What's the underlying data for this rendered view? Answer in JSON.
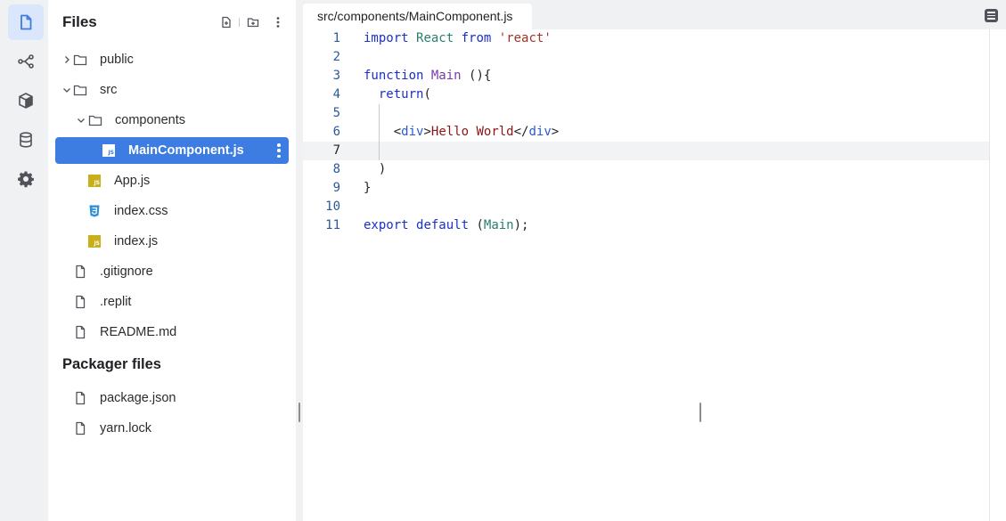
{
  "rail": {
    "items": [
      {
        "name": "files-icon",
        "active": true
      },
      {
        "name": "version-control-icon",
        "active": false
      },
      {
        "name": "packages-icon",
        "active": false
      },
      {
        "name": "database-icon",
        "active": false
      },
      {
        "name": "settings-icon",
        "active": false
      }
    ]
  },
  "files_panel": {
    "title": "Files",
    "tree": [
      {
        "label": "public",
        "type": "folder",
        "expanded": false,
        "depth": 0
      },
      {
        "label": "src",
        "type": "folder",
        "expanded": true,
        "depth": 0
      },
      {
        "label": "components",
        "type": "folder",
        "expanded": true,
        "depth": 1
      },
      {
        "label": "MainComponent.js",
        "type": "js",
        "depth": 2,
        "selected": true
      },
      {
        "label": "App.js",
        "type": "js",
        "depth": 1
      },
      {
        "label": "index.css",
        "type": "css",
        "depth": 1
      },
      {
        "label": "index.js",
        "type": "js",
        "depth": 1
      },
      {
        "label": ".gitignore",
        "type": "file",
        "depth": 0
      },
      {
        "label": ".replit",
        "type": "file",
        "depth": 0
      },
      {
        "label": "README.md",
        "type": "file",
        "depth": 0
      }
    ],
    "packager_title": "Packager files",
    "packager_files": [
      {
        "label": "package.json",
        "type": "file"
      },
      {
        "label": "yarn.lock",
        "type": "file"
      }
    ],
    "js_badge_text": "JS"
  },
  "editor": {
    "tab_label": "src/components/MainComponent.js",
    "current_line": 7,
    "lines": [
      {
        "n": "1",
        "tokens": [
          {
            "t": "import",
            "c": "kw"
          },
          {
            "t": " "
          },
          {
            "t": "React",
            "c": "cls"
          },
          {
            "t": " "
          },
          {
            "t": "from",
            "c": "kw"
          },
          {
            "t": " "
          },
          {
            "t": "'react'",
            "c": "str"
          }
        ]
      },
      {
        "n": "2",
        "tokens": []
      },
      {
        "n": "3",
        "tokens": [
          {
            "t": "function",
            "c": "kw"
          },
          {
            "t": " "
          },
          {
            "t": "Main",
            "c": "fn"
          },
          {
            "t": " (){",
            "c": "plain"
          }
        ]
      },
      {
        "n": "4",
        "tokens": [
          {
            "t": "  "
          },
          {
            "t": "return",
            "c": "kw"
          },
          {
            "t": "(",
            "c": "plain"
          }
        ]
      },
      {
        "n": "5",
        "tokens": []
      },
      {
        "n": "6",
        "tokens": [
          {
            "t": "    "
          },
          {
            "t": "<",
            "c": "plain"
          },
          {
            "t": "div",
            "c": "tag"
          },
          {
            "t": ">",
            "c": "plain"
          },
          {
            "t": "Hello World",
            "c": "txt"
          },
          {
            "t": "</",
            "c": "plain"
          },
          {
            "t": "div",
            "c": "tag"
          },
          {
            "t": ">",
            "c": "plain"
          }
        ]
      },
      {
        "n": "7",
        "tokens": []
      },
      {
        "n": "8",
        "tokens": [
          {
            "t": "  "
          },
          {
            "t": ")",
            "c": "plain"
          }
        ]
      },
      {
        "n": "9",
        "tokens": [
          {
            "t": "}",
            "c": "plain"
          }
        ]
      },
      {
        "n": "10",
        "tokens": []
      },
      {
        "n": "11",
        "tokens": [
          {
            "t": "export",
            "c": "kw"
          },
          {
            "t": " "
          },
          {
            "t": "default",
            "c": "kw"
          },
          {
            "t": " (",
            "c": "plain"
          },
          {
            "t": "Main",
            "c": "cls"
          },
          {
            "t": ");",
            "c": "plain"
          }
        ]
      }
    ]
  },
  "colors": {
    "accent": "#3d7ce0",
    "rail_active": "#d9e6fb",
    "js_badge": "#c9b01a",
    "css_badge": "#2f8fd8"
  }
}
